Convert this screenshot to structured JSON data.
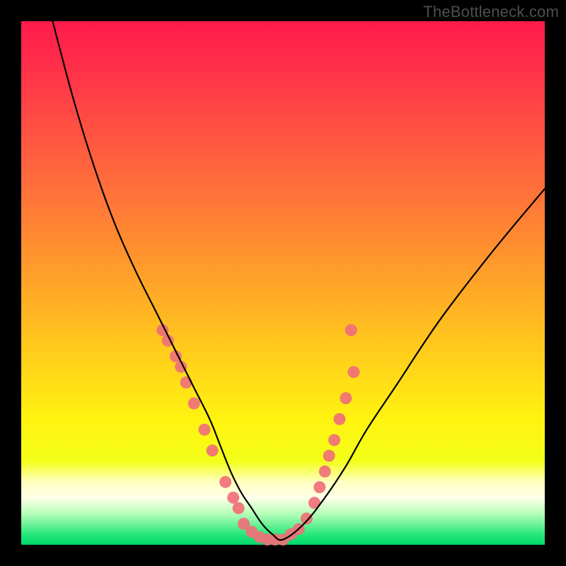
{
  "watermark": "TheBottleneck.com",
  "chart_data": {
    "type": "line",
    "title": "",
    "xlabel": "",
    "ylabel": "",
    "xlim": [
      0,
      100
    ],
    "ylim": [
      0,
      100
    ],
    "grid": false,
    "legend": false,
    "series": [
      {
        "name": "curve",
        "x": [
          6,
          10,
          14,
          18,
          22,
          26,
          30,
          33,
          36,
          38,
          40,
          42,
          44,
          46,
          48,
          50,
          54,
          58,
          62,
          66,
          72,
          80,
          90,
          100
        ],
        "y": [
          100,
          85,
          72,
          61,
          52,
          44,
          36,
          30,
          24,
          19,
          14,
          10,
          7,
          4,
          2,
          1,
          4,
          9,
          15,
          22,
          31,
          43,
          56,
          68
        ]
      }
    ],
    "markers": [
      {
        "name": "left-branch-dots",
        "x": [
          27,
          28,
          29.5,
          30.5,
          31.5,
          33,
          35,
          36.5,
          39,
          40.5,
          41.5
        ],
        "y": [
          41,
          39,
          36,
          34,
          31,
          27,
          22,
          18,
          12,
          9,
          7
        ]
      },
      {
        "name": "bottom-dots",
        "x": [
          42.5,
          44,
          45.5,
          47,
          48.5,
          50,
          51.5,
          53,
          54.5
        ],
        "y": [
          4,
          2.5,
          1.5,
          1,
          1,
          1,
          2,
          3,
          5
        ]
      },
      {
        "name": "right-branch-dots",
        "x": [
          56,
          57,
          58,
          58.8,
          59.8,
          60.8,
          62,
          63.5
        ],
        "y": [
          8,
          11,
          14,
          17,
          20,
          24,
          28,
          33
        ]
      },
      {
        "name": "right-outlier-dot",
        "x": [
          63
        ],
        "y": [
          41
        ]
      }
    ],
    "colors": {
      "curve": "#000000",
      "markers": "#f07078"
    }
  }
}
